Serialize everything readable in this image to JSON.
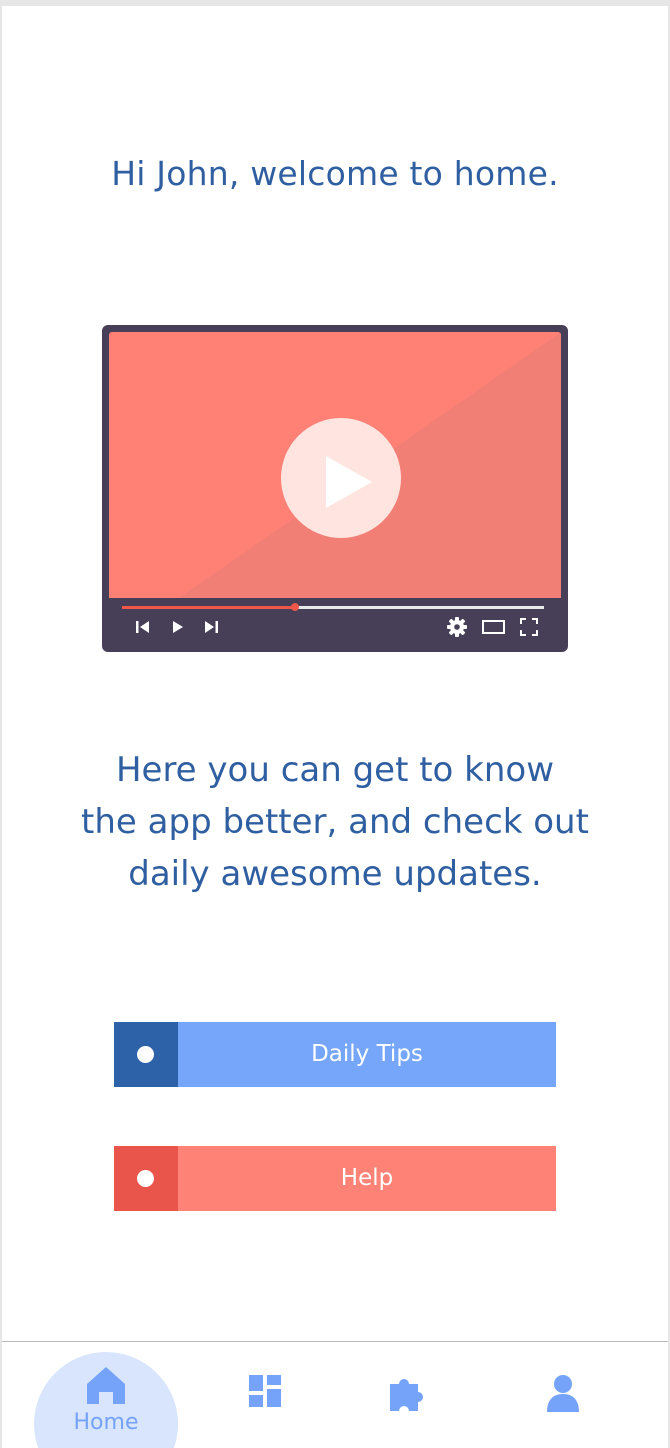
{
  "greeting": "Hi John, welcome to home.",
  "video": {
    "progress": 0.41,
    "icons": [
      "play-icon",
      "skip-back-icon",
      "play-small-icon",
      "skip-forward-icon",
      "settings-icon",
      "theater-mode-icon",
      "fullscreen-icon"
    ]
  },
  "description": {
    "line1": "Here you can get to know",
    "line2": "the app better, and check out",
    "line3": "daily awesome updates."
  },
  "buttons": {
    "daily_tips": "Daily Tips",
    "help": "Help"
  },
  "nav": {
    "home": "Home",
    "icons": [
      "home-icon",
      "dashboard-icon",
      "puzzle-icon",
      "profile-icon"
    ],
    "active": "home"
  },
  "colors": {
    "heading_text": "#2f5fa1",
    "player_frame": "#463f57",
    "player_screen": "#ff8176",
    "tips_accent": "#2e62a8",
    "tips_fill": "#75a6fa",
    "help_accent": "#e9554b",
    "help_fill": "#ff8276",
    "nav_icon": "#74a3f9",
    "nav_active_bg": "#d8e5fd"
  }
}
